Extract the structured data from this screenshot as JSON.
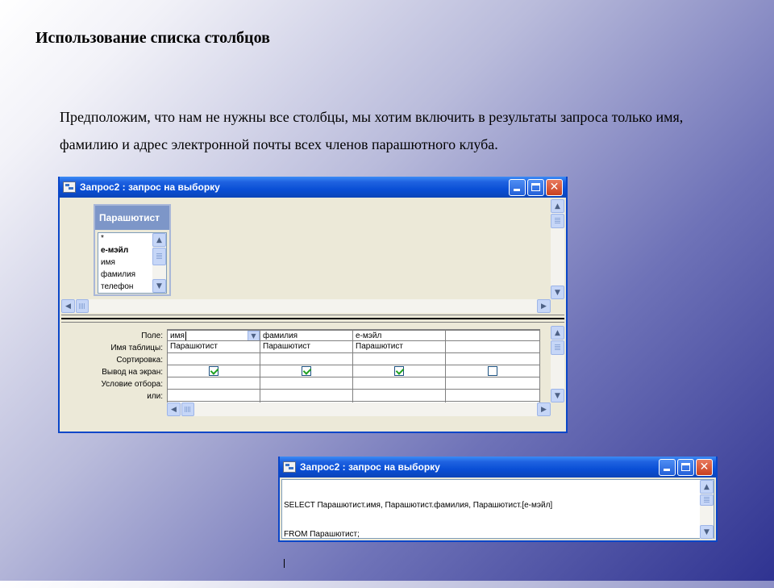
{
  "slide": {
    "title": "Использование списка столбцов",
    "paragraph": "Предположим, что нам не нужны все столбцы, мы хотим включить в результаты запроса только имя, фамилию и адрес электронной почты всех членов парашютного клуба."
  },
  "design_window": {
    "title": "Запрос2 : запрос на выборку",
    "table": {
      "name": "Парашютист",
      "fields": [
        "*",
        "е-мэйл",
        "имя",
        "фамилия",
        "телефон"
      ]
    },
    "row_labels": [
      "Поле:",
      "Имя таблицы:",
      "Сортировка:",
      "Вывод на экран:",
      "Условие отбора:",
      "или:"
    ],
    "columns": [
      {
        "field": "имя",
        "table": "Парашютист",
        "show": true
      },
      {
        "field": "фамилия",
        "table": "Парашютист",
        "show": true
      },
      {
        "field": "е-мэйл",
        "table": "Парашютист",
        "show": true
      },
      {
        "field": "",
        "table": "",
        "show": false
      }
    ]
  },
  "sql_window": {
    "title": "Запрос2 : запрос на выборку",
    "line1": "SELECT Парашютист.имя, Парашютист.фамилия, Парашютист.[е-мэйл]",
    "line2": "FROM Парашютист;"
  },
  "icons": {
    "window": "query-window-icon",
    "minimize": "minimize-icon",
    "maximize": "maximize-icon",
    "close": "close-icon",
    "arrow_up": "arrow-up-icon",
    "arrow_down": "arrow-down-icon",
    "arrow_left": "arrow-left-icon",
    "arrow_right": "arrow-right-icon"
  },
  "colors": {
    "titlebar": "#0a4fd6",
    "window_bg": "#ece9d8",
    "table_header": "#7d96c8",
    "check": "#21a121"
  }
}
